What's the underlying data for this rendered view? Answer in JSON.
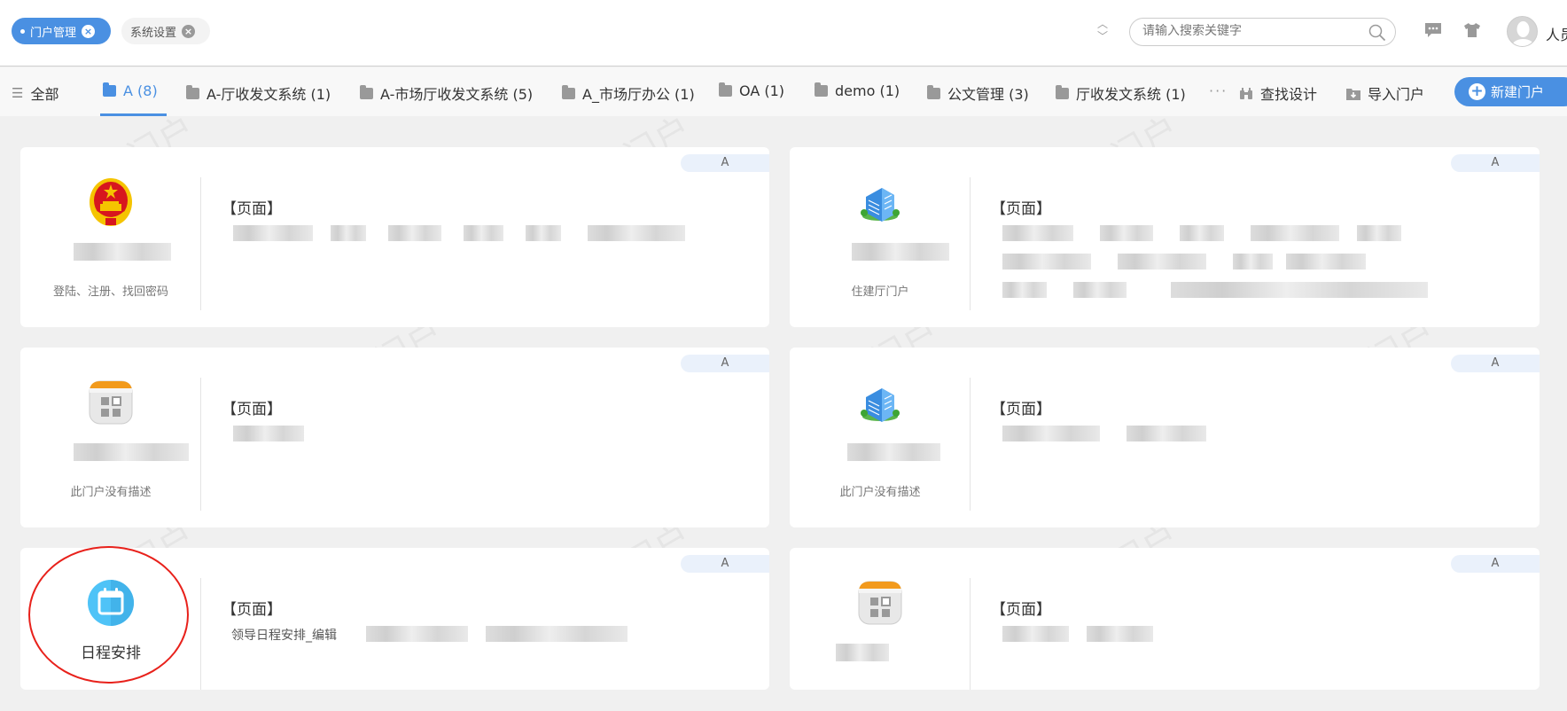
{
  "top_tabs": [
    {
      "label": "门户管理",
      "active": true
    },
    {
      "label": "系统设置",
      "active": false
    }
  ],
  "search": {
    "placeholder": "请输入搜索关键字"
  },
  "user": {
    "name": "人员"
  },
  "category_tabs": [
    {
      "label": "全部",
      "icon": "list-icon"
    },
    {
      "label": "A (8)",
      "icon": "folder-icon",
      "selected": true
    },
    {
      "label": "A-厅收发文系统 (1)",
      "icon": "folder-icon"
    },
    {
      "label": "A-市场厅收发文系统 (5)",
      "icon": "folder-icon"
    },
    {
      "label": "A_市场厅办公 (1)",
      "icon": "folder-icon"
    },
    {
      "label": "OA (1)",
      "icon": "folder-icon"
    },
    {
      "label": "demo (1)",
      "icon": "folder-icon"
    },
    {
      "label": "公文管理 (3)",
      "icon": "folder-icon"
    },
    {
      "label": "厅收发文系统 (1)",
      "icon": "folder-icon"
    }
  ],
  "more_label": "···",
  "find_design": "查找设计",
  "import_portal": "导入门户",
  "new_portal": "新建门户",
  "watermark": "门户",
  "colors": {
    "accent": "#4a90e2",
    "annotation": "#e8211b"
  },
  "cards": [
    {
      "badge": "A",
      "icon": "national-emblem-icon",
      "name": "",
      "desc": "登陆、注册、找回密码",
      "page_label": "【页面】",
      "lines": [
        ""
      ]
    },
    {
      "badge": "A",
      "icon": "building-icon",
      "name": "",
      "desc": "住建厅门户",
      "page_label": "【页面】",
      "lines": [
        "",
        "",
        ""
      ]
    },
    {
      "badge": "A",
      "icon": "app-grid-icon",
      "name": "",
      "desc": "此门户没有描述",
      "page_label": "【页面】",
      "lines": [
        ""
      ]
    },
    {
      "badge": "A",
      "icon": "building-icon",
      "name": "",
      "desc": "此门户没有描述",
      "page_label": "【页面】",
      "lines": [
        ""
      ]
    },
    {
      "badge": "A",
      "icon": "calendar-icon",
      "name": "日程安排",
      "desc": "",
      "page_label": "【页面】",
      "lines": [
        "领导日程安排_编辑"
      ]
    },
    {
      "badge": "A",
      "icon": "app-grid-icon",
      "name": "",
      "desc": "",
      "page_label": "【页面】",
      "lines": [
        ""
      ]
    }
  ]
}
